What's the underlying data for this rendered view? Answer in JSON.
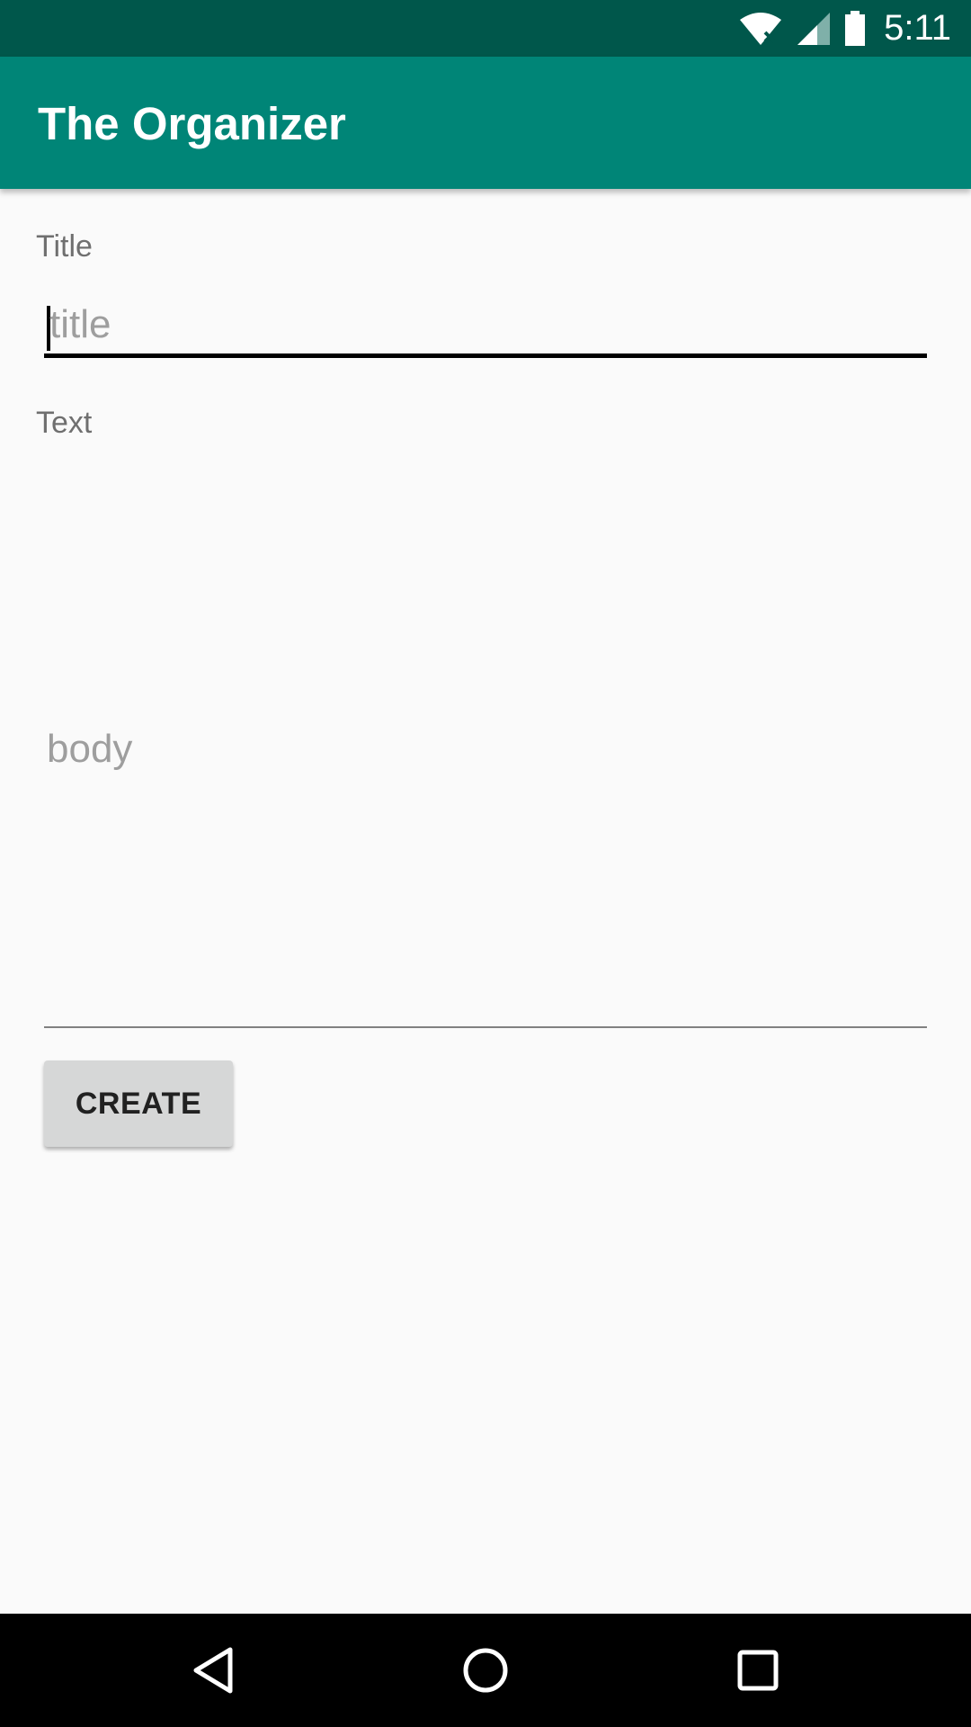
{
  "status_bar": {
    "time": "5:11",
    "icons": [
      "wifi-icon",
      "signal-icon",
      "battery-icon"
    ]
  },
  "app_bar": {
    "title": "The Organizer"
  },
  "form": {
    "title_label": "Title",
    "title_placeholder": "title",
    "text_label": "Text",
    "body_placeholder": "body",
    "create_label": "CREATE"
  },
  "nav_bar": {
    "icons": [
      "back-icon",
      "home-icon",
      "recents-icon"
    ]
  },
  "colors": {
    "primary": "#008577",
    "primary_dark": "#00574b",
    "background": "#fafafa"
  }
}
